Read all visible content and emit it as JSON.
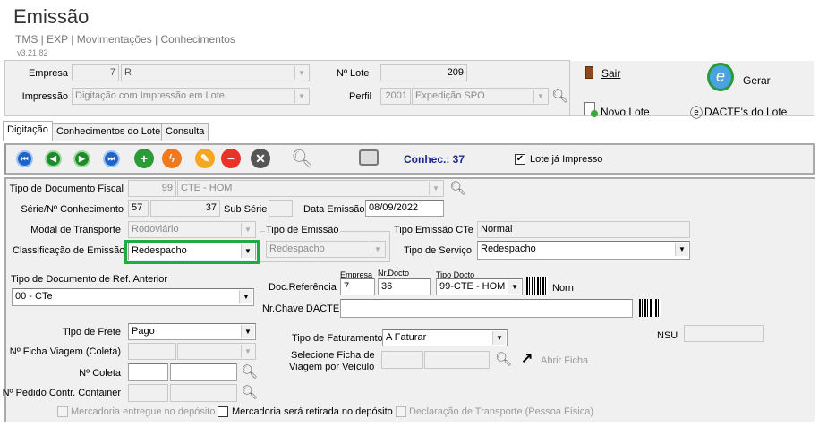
{
  "header": {
    "title": "Emissão",
    "breadcrumb": "TMS | EXP | Movimentações | Conhecimentos",
    "version": "v3.21.82"
  },
  "top": {
    "empresa_label": "Empresa",
    "empresa_code": "7",
    "empresa_name": "R",
    "impressao_label": "Impressão",
    "impressao_value": "Digitação com Impressão em Lote",
    "lote_label": "Nº Lote",
    "lote_value": "209",
    "perfil_label": "Perfil",
    "perfil_code": "2001",
    "perfil_name": "Expedição SPO"
  },
  "actions": {
    "sair": "Sair",
    "gerar": "Gerar",
    "novo_lote": "Novo Lote",
    "dactes": "DACTE's do Lote",
    "mdfe_logo": "MDFe"
  },
  "tabs": [
    "Digitação",
    "Conhecimentos do Lote",
    "Consulta"
  ],
  "toolbar": {
    "conhec_label": "Conhec.: 37",
    "lote_impresso_label": "Lote já Impresso",
    "lote_impresso_checked": true
  },
  "form": {
    "tipo_doc_fiscal_label": "Tipo de Documento Fiscal",
    "tipo_doc_fiscal_code": "99",
    "tipo_doc_fiscal_name": "CTE - HOM",
    "serie_label": "Série/Nº Conhecimento",
    "serie": "57",
    "numero": "37",
    "sub_serie_label": "Sub Série",
    "sub_serie": "",
    "data_emissao_label": "Data Emissão",
    "data_emissao": "08/09/2022",
    "modal_label": "Modal de Transporte",
    "modal": "Rodoviário",
    "tipo_emissao_group": "Tipo de Emissão",
    "tipo_emissao": "Redespacho",
    "tipo_emissao_cte_label": "Tipo Emissão CTe",
    "tipo_emissao_cte": "Normal",
    "classificacao_label": "Classificação de Emissão",
    "classificacao": "Redespacho",
    "tipo_servico_label": "Tipo de Serviço",
    "tipo_servico": "Redespacho",
    "ref_anterior_label": "Tipo de Documento de Ref. Anterior",
    "ref_anterior": "00 - CTe",
    "docref_label": "Doc.Referência",
    "docref_empresa_label": "Empresa",
    "docref_empresa": "7",
    "docref_nr_label": "Nr.Docto",
    "docref_nr": "36",
    "docref_tipo_label": "Tipo Docto",
    "docref_tipo": "99-CTE - HOM",
    "docref_status": "Norn",
    "chave_label": "Nr.Chave DACTE",
    "chave": "",
    "frete_label": "Tipo de Frete",
    "frete": "Pago",
    "ficha_label": "Nº Ficha Viagem (Coleta)",
    "coleta_label": "Nº Coleta",
    "pedido_label": "Nº Pedido Contr. Container",
    "faturamento_label": "Tipo de Faturamento",
    "faturamento": "A Faturar",
    "sel_ficha_label1": "Selecione Ficha de",
    "sel_ficha_label2": "Viagem por Veículo",
    "abrir_ficha": "Abrir Ficha",
    "nsu_label": "NSU",
    "nsu": "",
    "cb_entregue": "Mercadoria entregue no depósito",
    "cb_retirada": "Mercadoria será retirada no depósito",
    "cb_declaracao": "Declaração de Transporte (Pessoa Física)"
  },
  "colors": {
    "highlight": "#22aa44",
    "conhec": "#1a2a8a"
  }
}
